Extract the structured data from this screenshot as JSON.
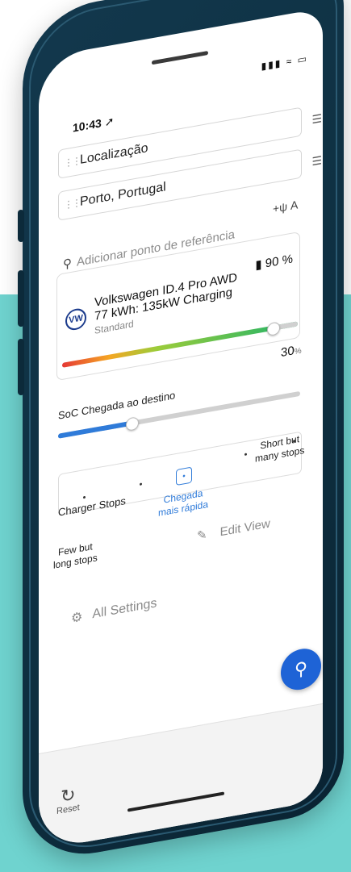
{
  "status": {
    "time": "10:43",
    "signal_glyph": "▮▮▮ ≈ ▭"
  },
  "search": {
    "start_label": "Localização",
    "destination_label": "Porto, Portugal",
    "add_waypoint": "Adicionar ponto de referência",
    "food_glyph": "+ψ A"
  },
  "vehicle": {
    "name_line1": "Volkswagen ID.4 Pro AWD",
    "name_line2": "77 kWh: 135kW Charging",
    "trim": "Standard",
    "battery": "90 %",
    "battery_fraction": 0.9,
    "logo_text": "VW"
  },
  "soc": {
    "label": "SoC Chegada ao destino",
    "value": "30",
    "unit": "%",
    "fraction": 0.3
  },
  "charger_stops": {
    "label": "Charger Stops",
    "left_line1": "Few but",
    "left_line2": "long stops",
    "mid_line1": "Chegada",
    "mid_line2": "mais rápida",
    "right_line1": "Short but",
    "right_line2": "many stops"
  },
  "actions": {
    "edit_view": "Edit View",
    "all_settings": "All Settings",
    "reset": "Reset"
  },
  "colors": {
    "accent": "#2f7bd9",
    "fab": "#1e63d6",
    "phone_frame": "#12384d",
    "background": "#6fd3cf"
  }
}
